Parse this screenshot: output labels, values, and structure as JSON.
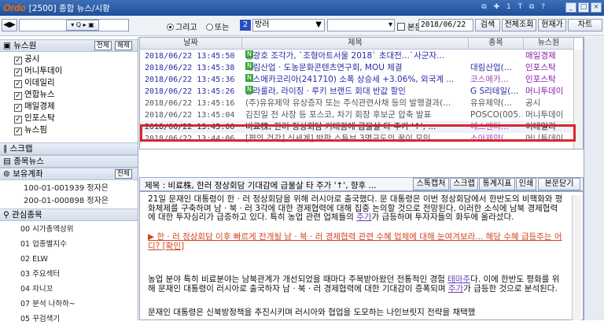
{
  "window": {
    "logo": "Ordo",
    "title": "[2500] 종합 뉴스/시황",
    "title_icons": "⧉ ✚ 1 T ⧉ ?",
    "controls": [
      "_",
      "□",
      "×"
    ]
  },
  "toolbar": {
    "nav_arrows": "◀▶",
    "tool_icons": "▾ Q ▸ ▣",
    "radio_all": "그리고",
    "radio_or": "또는",
    "num_badge": "2",
    "method": "방러",
    "body_check": "본문",
    "date": "2018/06/22",
    "search": "검색",
    "all_search": "전체조회",
    "current": "현재가",
    "chart": "차트"
  },
  "sidebar": {
    "news_header": "뉴스원",
    "news_pills": [
      "전체",
      "해제"
    ],
    "news_sources": [
      "공시",
      "머니투데이",
      "이데일리",
      "연합뉴스",
      "매일경제",
      "인포스탁",
      "뉴스핌"
    ],
    "script_header": "스크랩",
    "stock_news_header": "종목뉴스",
    "account_header": "보유계좌",
    "account_pill": "전체",
    "accounts": [
      "100-01-001939 정자은",
      "200-01-000898 정자은"
    ],
    "watch_header": "관심종목",
    "watch_items": [
      "00 시가총액상위",
      "01 업종별지수",
      "02 ELW",
      "03 주요섹터",
      "04 자니꼬",
      "07 분석 나하하~",
      "05 꾸검색기"
    ]
  },
  "news_list": {
    "headers": [
      "날짜",
      "제목",
      "종목",
      "뉴스원"
    ],
    "rows": [
      {
        "date": "2018/06/22 13:45:50",
        "new": true,
        "title": "김광호 조각가, `조형아트서울 2018` 초대전...`사군자...",
        "stock": "",
        "source": "매일경제",
        "color": "#2a2aa8"
      },
      {
        "date": "2018/06/22 13:45:38",
        "new": true,
        "title": "대림산업 · 도농문화콘텐츠연구회, MOU 체결",
        "stock": "대림산업(...",
        "source": "인포스탁",
        "color": "#2a2aa8"
      },
      {
        "date": "2018/06/22 13:45:36",
        "new": true,
        "title": "코스메카코리아(241710)  소폭 상승세 +3.06%, 외국계 ...",
        "stock": "코스메카...",
        "source": "인포스탁",
        "color": "#2a2aa8"
      },
      {
        "date": "2018/06/22 13:45:26",
        "new": true,
        "title": "팔라룰라, 라이징 · 루키 브랜드 회대 반값 할인",
        "stock": "G S리테일(...",
        "source": "머니투데이",
        "color": "#2a2aa8"
      },
      {
        "date": "2018/06/22 13:45:16",
        "new": false,
        "title": "(주)유유제약 유상증자 또는 주식관련사채 등의 발행결과(...",
        "stock": "유유제약(...",
        "source": "공시",
        "color": "#555555"
      },
      {
        "date": "2018/06/22 13:45:04",
        "new": false,
        "title": "김진일 전 사장 등 포스코, 차기 회장 후보군 압축 발표",
        "stock": "POSCO(005...",
        "source": "머니투데이",
        "color": "#555555"
      },
      {
        "date": "2018/06/22 13:45:00",
        "new": false,
        "title": "비료株, 한러 정상회담 기대감에 급물살 타 주가 '↑', ...",
        "stock": "에스앤디...",
        "source": "이데일리",
        "color": "#222222"
      },
      {
        "date": "2018/06/22 13:44:06",
        "new": false,
        "title": "[편의 건강] 신세계] 박판 스튜브 3명구도의 꿀이 모인...",
        "stock": "소아제약(...",
        "source": "머니투데이",
        "color": "#555555"
      }
    ]
  },
  "detail": {
    "title_label": "제목 : ",
    "title": "비료株, 한러 정상회담 기대감에 급물살 타 주가 '↑', 향후 ...",
    "buttons": [
      "스톡캡처",
      "스크랩",
      "통계지표",
      "인쇄",
      "본문닫기"
    ],
    "p1_a": "21일 문재인 대통령이 한 · 러 정상회담을 위해 러시아로 출국했다. 문 대통령은 이번 정상회담에서 한반도의 비핵화와 평화체제를 구축하며 남 · 북 · 러 3각에 대한 경제협력에 대해 집중 논의할 것으로 전망된다. 이러한 소식에 남북 경제협력에 대한 투자심리가 급증하고 있다. 특히 농업 관련 업체들의 ",
    "p1_link": "주가",
    "p1_b": "가 급등하며 투자자들의 화두에 올라섰다.",
    "p2": "▶ 한 · 러 정상회담 이후 빠르게 전개될 남 · 북 · 러 경제협력 관련 수혜 업체에 대해 눈여겨보라... 해당 수혜 급등주는 어디? [확인]",
    "p3_a": "농업 분야 특히 비료분야는 남북관계가 개선되었을 때마다 주목받아왔던 전통적인 경험 ",
    "p3_link1": "테마주",
    "p3_b": "다. 이에 한반도 평화를 위해 문재인 대통령이 러시아로 출국하자 남 · 북 · 러 경제협력에 대한 기대감이 증폭되며 ",
    "p3_link2": "주가",
    "p3_c": "가 급등한 것으로 분석된다.",
    "p4": "문재인 대통령은 신북방정책을 추진시키며 러시아와 협업을 도모하는 나인브릿지 전략을 채택했"
  }
}
